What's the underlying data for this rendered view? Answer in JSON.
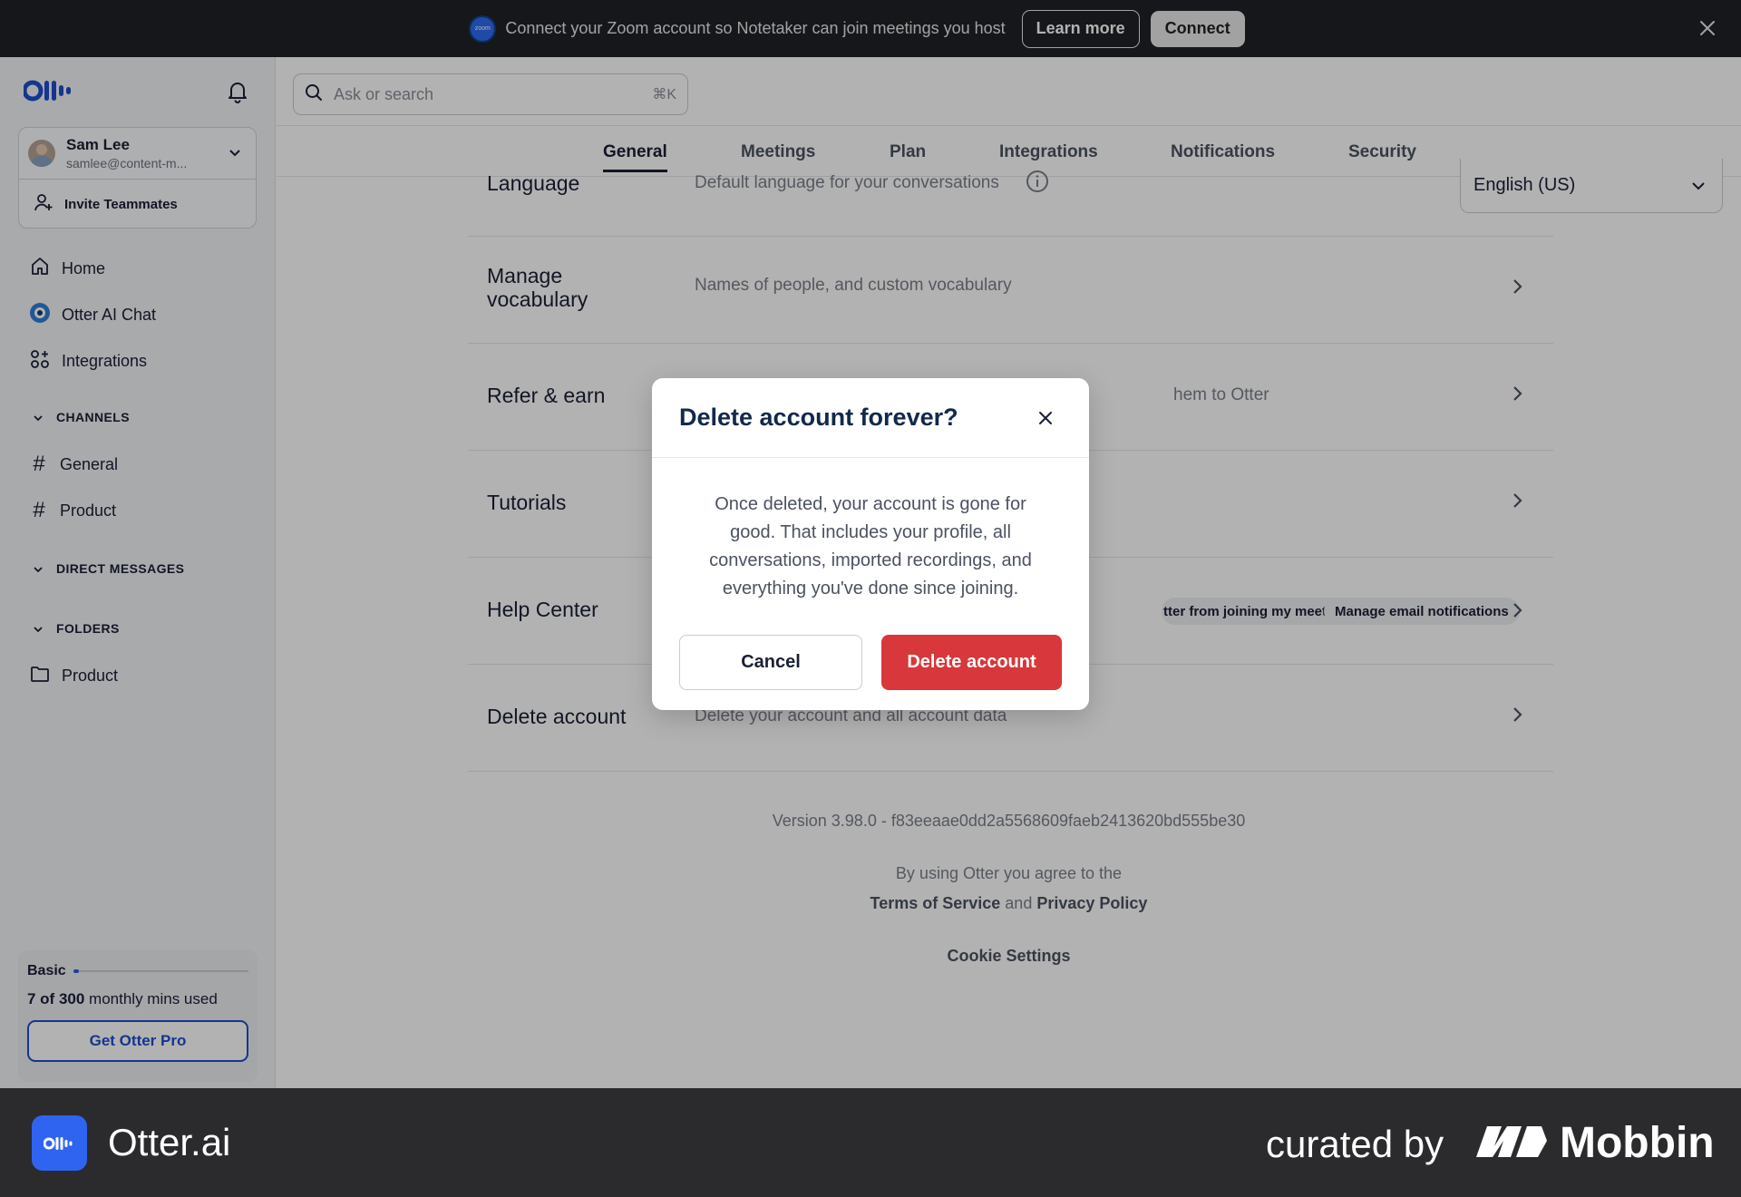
{
  "banner": {
    "zoom_badge": "zoom",
    "text": "Connect your Zoom account so Notetaker can join meetings you host",
    "learn_more": "Learn more",
    "connect": "Connect"
  },
  "sidebar": {
    "user_name": "Sam Lee",
    "user_email": "samlee@content-m...",
    "invite": "Invite Teammates",
    "nav": [
      {
        "label": "Home",
        "icon": "home-icon"
      },
      {
        "label": "Otter AI Chat",
        "icon": "otter-ai-chat-icon"
      },
      {
        "label": "Integrations",
        "icon": "integrations-icon"
      }
    ],
    "channels_label": "CHANNELS",
    "channels": [
      "General",
      "Product"
    ],
    "direct_messages_label": "DIRECT MESSAGES",
    "folders_label": "FOLDERS",
    "folders": [
      "Product"
    ],
    "plan": {
      "name": "Basic",
      "used": "7 of 300",
      "used_suffix": "monthly mins used",
      "usage_fraction": 0.023,
      "cta": "Get Otter Pro"
    }
  },
  "search": {
    "placeholder": "Ask or search",
    "shortcut": "⌘K"
  },
  "tabs": [
    {
      "label": "General",
      "active": true
    },
    {
      "label": "Meetings",
      "active": false
    },
    {
      "label": "Plan",
      "active": false
    },
    {
      "label": "Integrations",
      "active": false
    },
    {
      "label": "Notifications",
      "active": false
    },
    {
      "label": "Security",
      "active": false
    }
  ],
  "settings": {
    "language": {
      "title": "Language",
      "desc": "Default language for your conversations",
      "value": "English (US)"
    },
    "vocabulary": {
      "title_line1": "Manage",
      "title_line2": "vocabulary",
      "desc": "Names of people, and custom vocabulary"
    },
    "refer": {
      "title": "Refer & earn",
      "desc": "hem to Otter"
    },
    "tutorials": {
      "title": "Tutorials"
    },
    "help": {
      "title": "Help Center",
      "chips": [
        "tter from joining my meetings",
        "Manage email notifications"
      ]
    },
    "delete": {
      "title": "Delete account",
      "desc": "Delete your account and all account data"
    }
  },
  "footer": {
    "version": "Version 3.98.0 - f83eeaae0dd2a5568609faeb2413620bd555be30",
    "agree": "By using Otter you agree to the",
    "terms": "Terms of Service",
    "and": "and",
    "privacy": "Privacy Policy",
    "cookies": "Cookie Settings"
  },
  "modal": {
    "title": "Delete account forever?",
    "body": "Once deleted, your account is gone for good. That includes your profile, all conversations, imported recordings, and everything you've done since joining.",
    "cancel": "Cancel",
    "confirm": "Delete account"
  },
  "brand": {
    "app_name": "Otter.ai",
    "curated_by": "curated by",
    "mobbin": "Mobbin"
  },
  "colors": {
    "accent": "#1f4ccc",
    "danger": "#d8373b",
    "banner_bg": "#1f2226",
    "brand_bar": "#2b2b2d"
  }
}
